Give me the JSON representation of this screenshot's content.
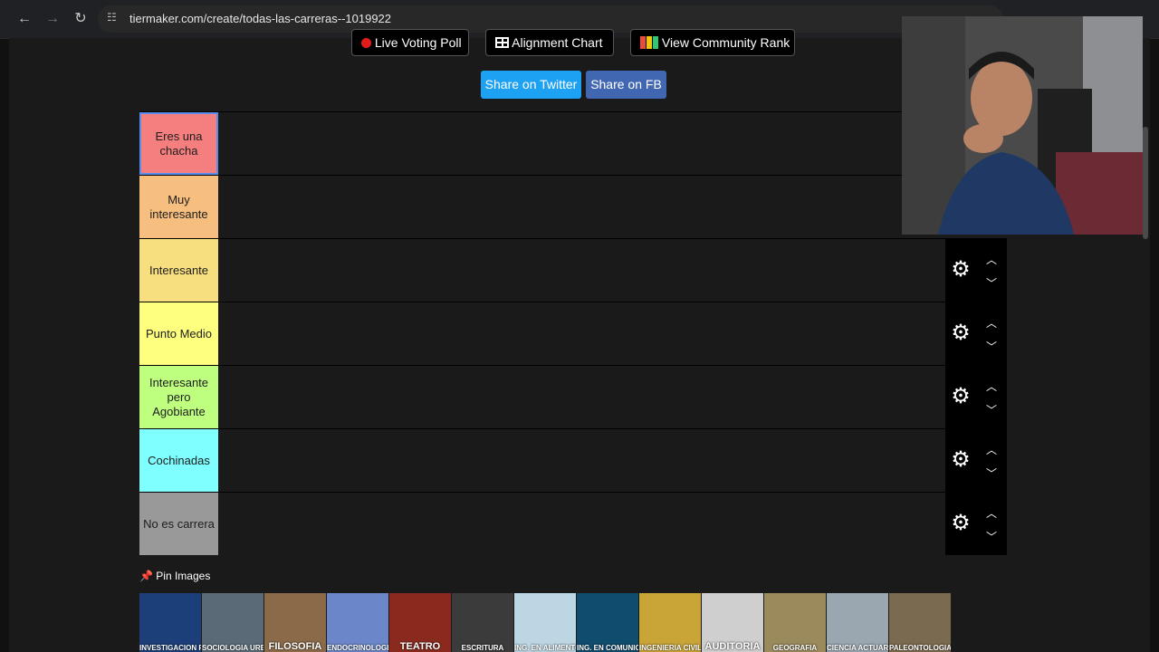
{
  "browser": {
    "url": "tiermaker.com/create/todas-las-carreras--1019922"
  },
  "buttons": {
    "live_voting": "Live Voting Poll",
    "alignment": "Alignment Chart",
    "community": "View Community Rank",
    "share_twitter": "Share on Twitter",
    "share_fb": "Share on FB"
  },
  "tiers": [
    {
      "label": "Eres una chacha",
      "color": "#f57f7f"
    },
    {
      "label": "Muy interesante",
      "color": "#f7bf7f"
    },
    {
      "label": "Interesante",
      "color": "#f7df7f"
    },
    {
      "label": "Punto Medio",
      "color": "#ffff7f"
    },
    {
      "label": "Interesante pero Agobiante",
      "color": "#bfff7f"
    },
    {
      "label": "Cochinadas",
      "color": "#7fffff"
    },
    {
      "label": "No es carrera",
      "color": "#999999"
    }
  ],
  "pin": {
    "title": "Pin Images"
  },
  "images": [
    "INVESTIGACION FEDERAL",
    "SOCIOLOGIA URBANA",
    "FILOSOFIA",
    "ENDOCRINOLOGIA",
    "TEATRO",
    "ESCRITURA",
    "ING. EN ALIMENTOS",
    "ING. EN COMUNICACIONES",
    "INGENIERIA CIVIL",
    "AUDITORIA",
    "GEOGRAFIA",
    "CIENCIA ACTUARIAL",
    "PALEONTOLOGIA"
  ]
}
